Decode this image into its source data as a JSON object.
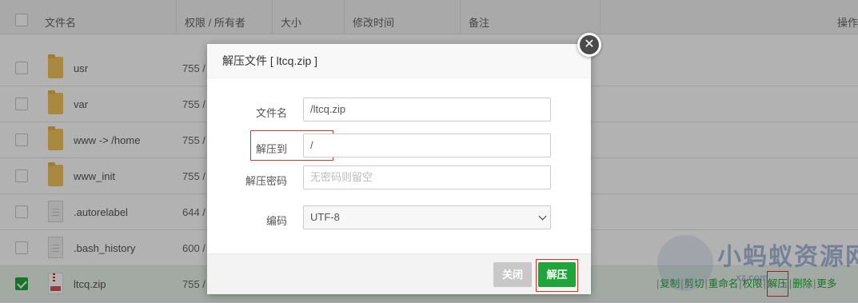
{
  "table": {
    "headers": {
      "filename": "文件名",
      "perm_owner": "权限 / 所有者",
      "size": "大小",
      "mtime": "修改时间",
      "remark": "备注",
      "actions": "操作"
    },
    "rows": [
      {
        "name": "usr",
        "perm": "755 /",
        "type": "folder",
        "selected": false
      },
      {
        "name": "var",
        "perm": "755 /",
        "type": "folder",
        "selected": false
      },
      {
        "name": "www -> /home",
        "perm": "755 /",
        "type": "folder",
        "selected": false
      },
      {
        "name": "www_init",
        "perm": "755 /",
        "type": "folder",
        "selected": false
      },
      {
        "name": ".autorelabel",
        "perm": "644 /",
        "type": "file",
        "selected": false
      },
      {
        "name": ".bash_history",
        "perm": "600 /",
        "type": "file",
        "selected": false
      },
      {
        "name": "ltcq.zip",
        "perm": "755 /",
        "type": "zip",
        "selected": true
      }
    ],
    "row_actions": {
      "copy": "复制",
      "cut": "剪切",
      "rename": "重命名",
      "permissions": "权限",
      "unzip": "解压",
      "delete": "删除",
      "more": "更多"
    }
  },
  "dialog": {
    "title": "解压文件 [ ltcq.zip ]",
    "close_icon": "close-icon",
    "fields": {
      "filename_label": "文件名",
      "filename_value": "/ltcq.zip",
      "target_label": "解压到",
      "target_value": "/",
      "password_label": "解压密码",
      "password_placeholder": "无密码则留空",
      "encoding_label": "编码",
      "encoding_value": "UTF-8"
    },
    "buttons": {
      "close": "关闭",
      "unzip": "解压"
    }
  },
  "watermark": {
    "text": "小蚂蚁资源网",
    "url": "xz.com"
  },
  "colors": {
    "accent_green": "#20a53a",
    "highlight_red": "#d9352b"
  }
}
